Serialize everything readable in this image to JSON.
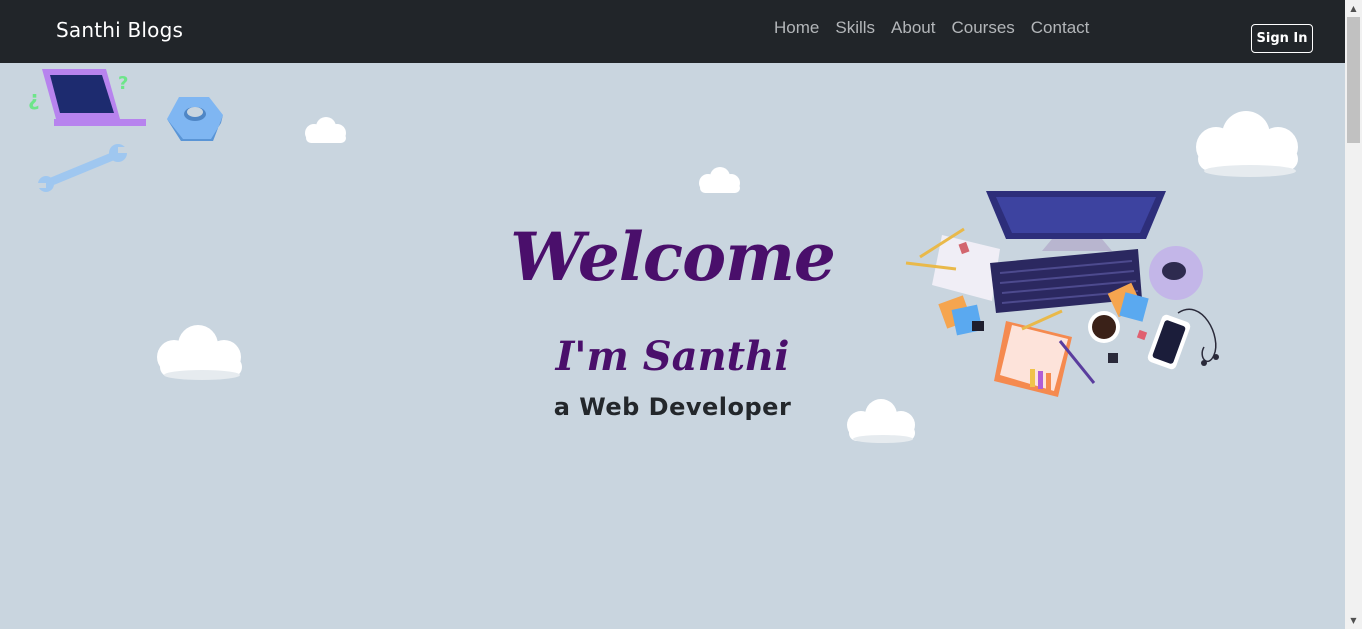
{
  "navbar": {
    "brand": "Santhi Blogs",
    "links": [
      "Home",
      "Skills",
      "About",
      "Courses",
      "Contact"
    ],
    "signin_label": "Sign In"
  },
  "hero": {
    "welcome": "Welcome",
    "intro": "I'm Santhi",
    "role": "a Web Developer"
  },
  "colors": {
    "navbar_bg": "#212529",
    "page_bg": "#c9d5df",
    "heading_purple": "#4a0f6b"
  }
}
